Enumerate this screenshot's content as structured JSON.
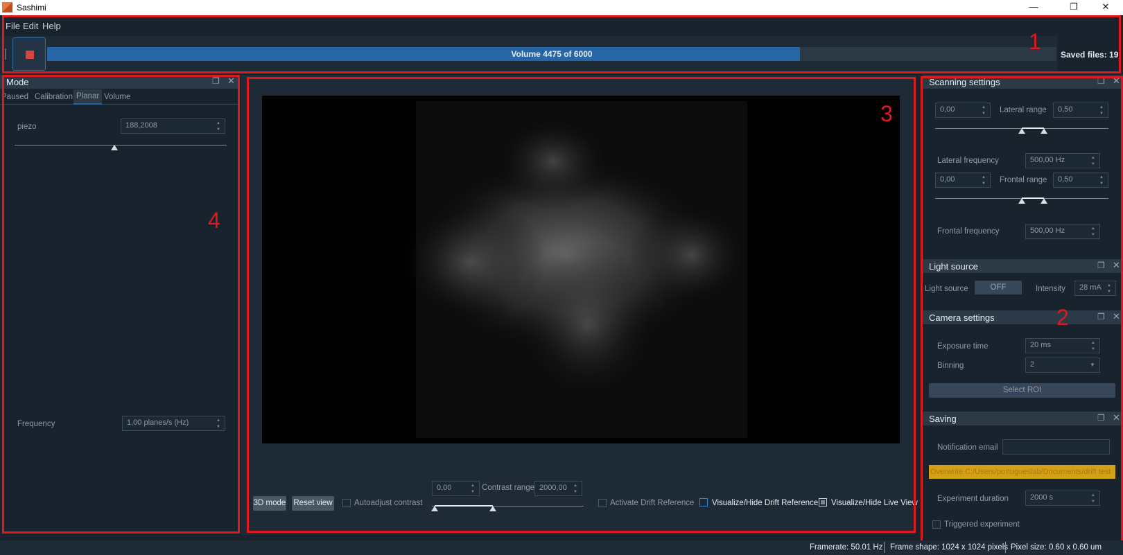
{
  "window": {
    "title": "Sashimi",
    "controls": {
      "minimize": "—",
      "maximize": "❐",
      "close": "✕"
    }
  },
  "menu": [
    "File",
    "Edit",
    "Help"
  ],
  "toolbar": {
    "stop_icon": "stop-square-icon",
    "progress_text": "Volume 4475 of 6000",
    "progress_fraction": 0.7458,
    "saved_files": "Saved files: 19"
  },
  "mode_panel": {
    "title": "Mode",
    "tabs": [
      "Paused",
      "Calibration",
      "Planar",
      "Volume"
    ],
    "selected_tab": "Planar",
    "piezo_label": "piezo",
    "piezo_value": "188,2008",
    "frequency_label": "Frequency",
    "frequency_value": "1,00 planes/s (Hz)"
  },
  "viewer": {
    "buttons": {
      "mode3d": "3D mode",
      "reset": "Reset view"
    },
    "autoadjust_label": "Autoadjust contrast",
    "contrast_min": "0,00",
    "contrast_label": "Contrast range",
    "contrast_max": "2000,00",
    "drift_ref_label": "Activate Drift Reference",
    "vis_drift_label": "Visualize/Hide Drift Reference",
    "vis_live_label": "Visualize/Hide Live View"
  },
  "scanning": {
    "title": "Scanning settings",
    "lateral_offset": "0,00",
    "lateral_range_label": "Lateral range",
    "lateral_range": "0,50",
    "lateral_freq_label": "Lateral frequency",
    "lateral_freq": "500,00 Hz",
    "frontal_offset": "0,00",
    "frontal_range_label": "Frontal range",
    "frontal_range": "0,50",
    "frontal_freq_label": "Frontal frequency",
    "frontal_freq": "500,00 Hz"
  },
  "light": {
    "title": "Light source",
    "label": "Light source",
    "toggle": "OFF",
    "intensity_label": "Intensity",
    "intensity": "28 mA"
  },
  "camera": {
    "title": "Camera settings",
    "exposure_label": "Exposure time",
    "exposure": "20 ms",
    "binning_label": "Binning",
    "binning": "2",
    "roi_button": "Select ROI"
  },
  "saving": {
    "title": "Saving",
    "email_label": "Notification email",
    "email_value": "",
    "overwrite_text": "Overwrite C:/Users/portugueslab/Documents/drift test",
    "duration_label": "Experiment duration",
    "duration": "2000 s",
    "triggered_label": "Triggered experiment"
  },
  "statusbar": {
    "framerate": "Framerate: 50.01 Hz",
    "frame_shape": "Frame shape: 1024 x 1024 pixels",
    "pixel_size": "Pixel size: 0.60 x 0.60 um"
  },
  "annotations": [
    "1",
    "2",
    "3",
    "4"
  ],
  "colors": {
    "accent": "#2766a6",
    "annotation": "#e0191c",
    "warning": "#d4a017"
  }
}
